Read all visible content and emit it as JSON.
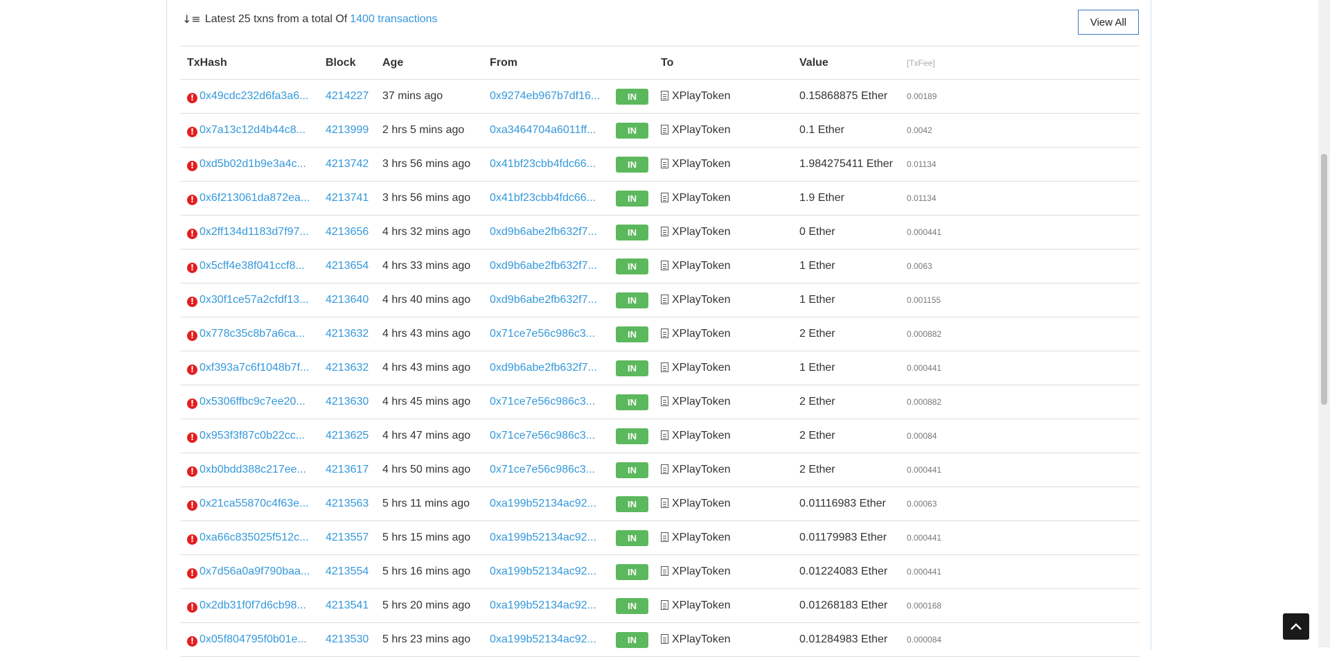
{
  "summary": {
    "prefix": "Latest 25 txns from a total Of",
    "link": "1400 transactions",
    "sort_icon": "sort-amount-down-icon"
  },
  "view_all_label": "View All",
  "columns": {
    "txhash": "TxHash",
    "block": "Block",
    "age": "Age",
    "from": "From",
    "to": "To",
    "value": "Value",
    "fee": "[TxFee]"
  },
  "rows": [
    {
      "hash": "0x49cdc232d6fa3a6...",
      "block": "4214227",
      "age": "37 mins ago",
      "from": "0x9274eb967b7df16...",
      "dir": "IN",
      "to": "XPlayToken",
      "value": "0.15868875 Ether",
      "fee": "0.00189"
    },
    {
      "hash": "0x7a13c12d4b44c8...",
      "block": "4213999",
      "age": "2 hrs 5 mins ago",
      "from": "0xa3464704a6011ff...",
      "dir": "IN",
      "to": "XPlayToken",
      "value": "0.1 Ether",
      "fee": "0.0042"
    },
    {
      "hash": "0xd5b02d1b9e3a4c...",
      "block": "4213742",
      "age": "3 hrs 56 mins ago",
      "from": "0x41bf23cbb4fdc66...",
      "dir": "IN",
      "to": "XPlayToken",
      "value": "1.984275411 Ether",
      "fee": "0.01134"
    },
    {
      "hash": "0x6f213061da872ea...",
      "block": "4213741",
      "age": "3 hrs 56 mins ago",
      "from": "0x41bf23cbb4fdc66...",
      "dir": "IN",
      "to": "XPlayToken",
      "value": "1.9 Ether",
      "fee": "0.01134"
    },
    {
      "hash": "0x2ff134d1183d7f97...",
      "block": "4213656",
      "age": "4 hrs 32 mins ago",
      "from": "0xd9b6abe2fb632f7...",
      "dir": "IN",
      "to": "XPlayToken",
      "value": "0 Ether",
      "fee": "0.000441"
    },
    {
      "hash": "0x5cff4e38f041ccf8...",
      "block": "4213654",
      "age": "4 hrs 33 mins ago",
      "from": "0xd9b6abe2fb632f7...",
      "dir": "IN",
      "to": "XPlayToken",
      "value": "1 Ether",
      "fee": "0.0063"
    },
    {
      "hash": "0x30f1ce57a2cfdf13...",
      "block": "4213640",
      "age": "4 hrs 40 mins ago",
      "from": "0xd9b6abe2fb632f7...",
      "dir": "IN",
      "to": "XPlayToken",
      "value": "1 Ether",
      "fee": "0.001155"
    },
    {
      "hash": "0x778c35c8b7a6ca...",
      "block": "4213632",
      "age": "4 hrs 43 mins ago",
      "from": "0x71ce7e56c986c3...",
      "dir": "IN",
      "to": "XPlayToken",
      "value": "2 Ether",
      "fee": "0.000882"
    },
    {
      "hash": "0xf393a7c6f1048b7f...",
      "block": "4213632",
      "age": "4 hrs 43 mins ago",
      "from": "0xd9b6abe2fb632f7...",
      "dir": "IN",
      "to": "XPlayToken",
      "value": "1 Ether",
      "fee": "0.000441"
    },
    {
      "hash": "0x5306ffbc9c7ee20...",
      "block": "4213630",
      "age": "4 hrs 45 mins ago",
      "from": "0x71ce7e56c986c3...",
      "dir": "IN",
      "to": "XPlayToken",
      "value": "2 Ether",
      "fee": "0.000882"
    },
    {
      "hash": "0x953f3f87c0b22cc...",
      "block": "4213625",
      "age": "4 hrs 47 mins ago",
      "from": "0x71ce7e56c986c3...",
      "dir": "IN",
      "to": "XPlayToken",
      "value": "2 Ether",
      "fee": "0.00084"
    },
    {
      "hash": "0xb0bdd388c217ee...",
      "block": "4213617",
      "age": "4 hrs 50 mins ago",
      "from": "0x71ce7e56c986c3...",
      "dir": "IN",
      "to": "XPlayToken",
      "value": "2 Ether",
      "fee": "0.000441"
    },
    {
      "hash": "0x21ca55870c4f63e...",
      "block": "4213563",
      "age": "5 hrs 11 mins ago",
      "from": "0xa199b52134ac92...",
      "dir": "IN",
      "to": "XPlayToken",
      "value": "0.01116983 Ether",
      "fee": "0.00063"
    },
    {
      "hash": "0xa66c835025f512c...",
      "block": "4213557",
      "age": "5 hrs 15 mins ago",
      "from": "0xa199b52134ac92...",
      "dir": "IN",
      "to": "XPlayToken",
      "value": "0.01179983 Ether",
      "fee": "0.000441"
    },
    {
      "hash": "0x7d56a0a9f790baa...",
      "block": "4213554",
      "age": "5 hrs 16 mins ago",
      "from": "0xa199b52134ac92...",
      "dir": "IN",
      "to": "XPlayToken",
      "value": "0.01224083 Ether",
      "fee": "0.000441"
    },
    {
      "hash": "0x2db31f0f7d6cb98...",
      "block": "4213541",
      "age": "5 hrs 20 mins ago",
      "from": "0xa199b52134ac92...",
      "dir": "IN",
      "to": "XPlayToken",
      "value": "0.01268183 Ether",
      "fee": "0.000168"
    },
    {
      "hash": "0x05f804795f0b01e...",
      "block": "4213530",
      "age": "5 hrs 23 mins ago",
      "from": "0xa199b52134ac92...",
      "dir": "IN",
      "to": "XPlayToken",
      "value": "0.01284983 Ether",
      "fee": "0.000084"
    }
  ],
  "colors": {
    "link": "#3498db",
    "in_badge": "#5cb85c",
    "error_icon": "#e41e1e",
    "button_border": "#3a7abf"
  },
  "icons": {
    "row_status": "exclamation-circle-icon",
    "to_type": "file-document-icon",
    "back_to_top": "chevron-up-icon"
  }
}
